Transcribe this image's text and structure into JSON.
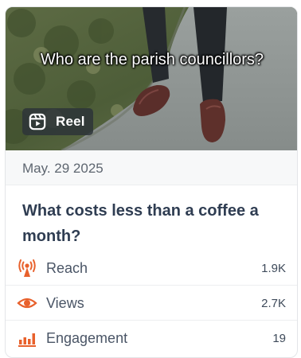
{
  "post": {
    "caption": "Who are the parish councillors?",
    "badge_label": "Reel",
    "date": "May. 29 2025",
    "title": "What costs less than a coffee a month?"
  },
  "metrics": [
    {
      "icon": "reach-icon",
      "label": "Reach",
      "value": "1.9K"
    },
    {
      "icon": "eye-icon",
      "label": "Views",
      "value": "2.7K"
    },
    {
      "icon": "bar-chart-icon",
      "label": "Engagement",
      "value": "19"
    }
  ],
  "colors": {
    "accent": "#e8612c",
    "title": "#2f3d52",
    "label": "#4a5566"
  }
}
